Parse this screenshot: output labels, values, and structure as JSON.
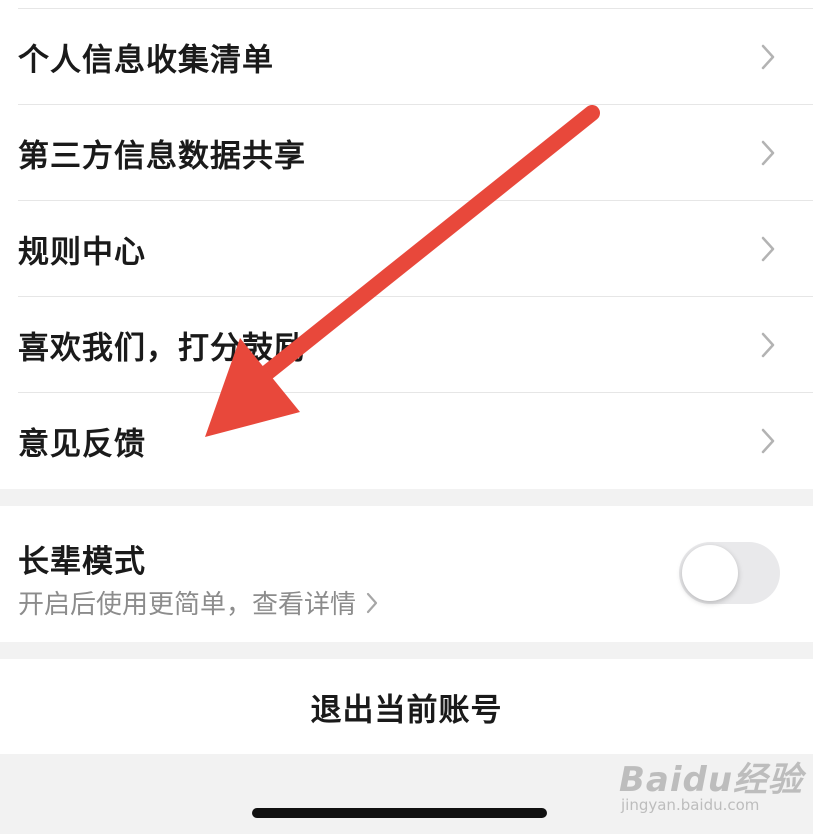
{
  "menu": {
    "items": [
      {
        "label": "个人信息收集清单"
      },
      {
        "label": "第三方信息数据共享"
      },
      {
        "label": "规则中心"
      },
      {
        "label": "喜欢我们，打分鼓励"
      },
      {
        "label": "意见反馈"
      }
    ]
  },
  "elder_mode": {
    "title": "长辈模式",
    "subtitle": "开启后使用更简单，查看详情",
    "toggle_on": false
  },
  "logout": {
    "label": "退出当前账号"
  },
  "watermark": {
    "brand": "Baidu经验",
    "domain": "jingyan.baidu.com"
  },
  "colors": {
    "annotation_arrow": "#e8483b",
    "toggle_off": "#e9e9eb",
    "text_primary": "#1a1a1a",
    "text_secondary": "#8c8c8c"
  }
}
